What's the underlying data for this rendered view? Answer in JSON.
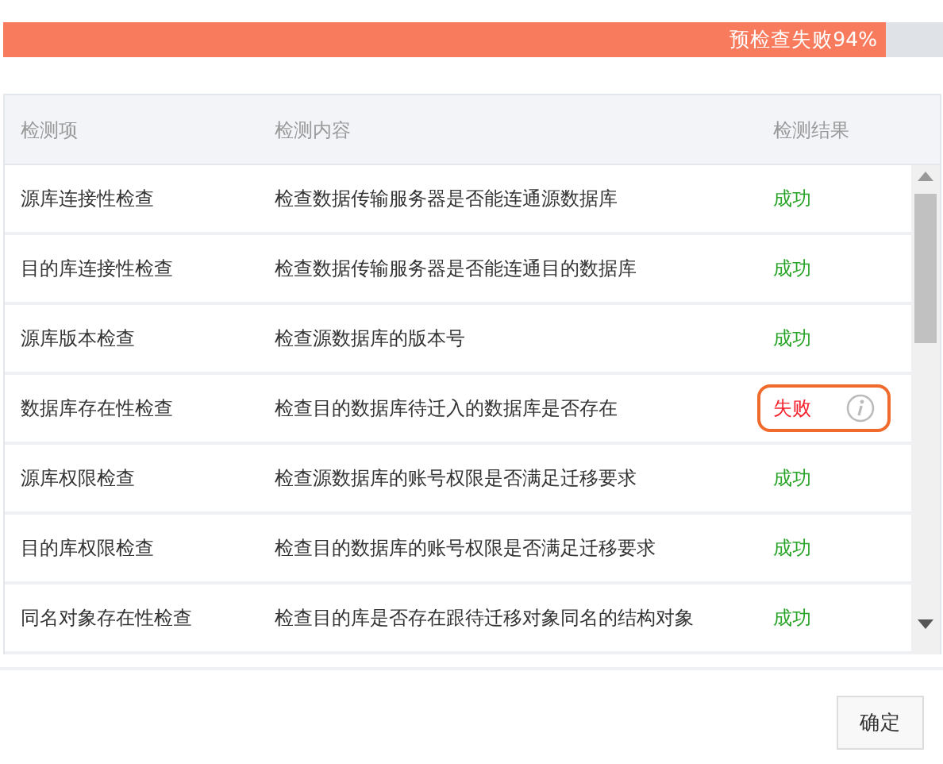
{
  "progress": {
    "label": "预检查失败94%",
    "level": 0.94,
    "failed": true
  },
  "table": {
    "columns": [
      "检测项",
      "检测内容",
      "检测结果"
    ],
    "rows": [
      {
        "item": "源库连接性检查",
        "content": "检查数据传输服务器是否能连通源数据库",
        "result": "成功",
        "failed": false
      },
      {
        "item": "目的库连接性检查",
        "content": "检查数据传输服务器是否能连通目的数据库",
        "result": "成功",
        "failed": false
      },
      {
        "item": "源库版本检查",
        "content": "检查源数据库的版本号",
        "result": "成功",
        "failed": false
      },
      {
        "item": "数据库存在性检查",
        "content": "检查目的数据库待迁入的数据库是否存在",
        "result": "失败",
        "failed": true
      },
      {
        "item": "源库权限检查",
        "content": "检查源数据库的账号权限是否满足迁移要求",
        "result": "成功",
        "failed": false
      },
      {
        "item": "目的库权限检查",
        "content": "检查目的数据库的账号权限是否满足迁移要求",
        "result": "成功",
        "failed": false
      },
      {
        "item": "同名对象存在性检查",
        "content": "检查目的库是否存在跟待迁移对象同名的结构对象",
        "result": "成功",
        "failed": false
      }
    ]
  },
  "buttons": [
    {
      "label": "确定"
    }
  ]
}
